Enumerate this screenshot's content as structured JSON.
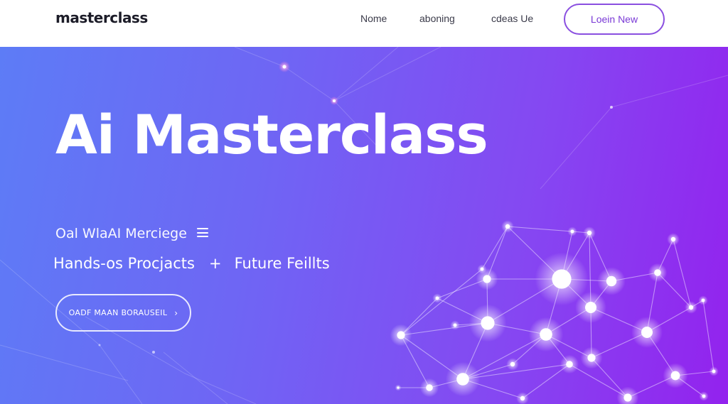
{
  "header": {
    "brand": "masterclass",
    "nav": [
      {
        "label": "Nome"
      },
      {
        "label": "aboning"
      },
      {
        "label": "cdeas Ue"
      }
    ],
    "login_label": "Loein New"
  },
  "hero": {
    "title": "Ai Masterclass",
    "tagline": "Oal WlaAI Merciege",
    "feature_1": "Hands-os Procjacts",
    "separator": "+",
    "feature_2": "Future Feillts",
    "cta_label": "OADF MAAN BORAUSEIL",
    "cta_icon": "chevron-right-icon",
    "menu_icon": "hamburger-menu-icon"
  },
  "colors": {
    "brand_text": "#1c1c28",
    "accent": "#8a4fe0",
    "hero_gradient_start": "#5d7cf6",
    "hero_gradient_end": "#9322ee"
  }
}
